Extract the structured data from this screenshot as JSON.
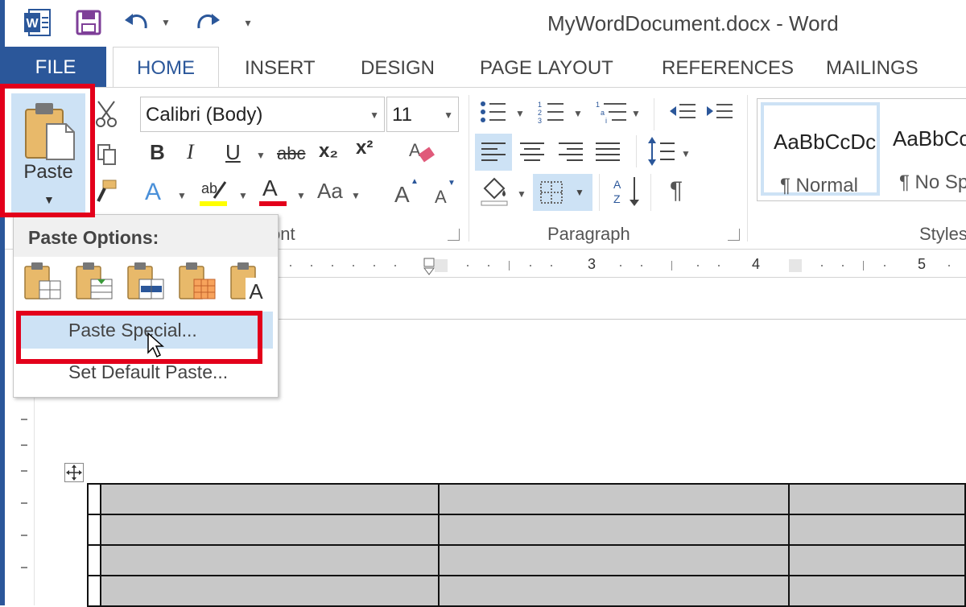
{
  "title_bar": {
    "title": "MyWordDocument.docx - Word",
    "icons": [
      "word-app-icon",
      "save-icon",
      "undo-icon",
      "redo-icon",
      "customize-qat-icon"
    ]
  },
  "tabs": [
    {
      "label": "FILE"
    },
    {
      "label": "HOME"
    },
    {
      "label": "INSERT"
    },
    {
      "label": "DESIGN"
    },
    {
      "label": "PAGE LAYOUT"
    },
    {
      "label": "REFERENCES"
    },
    {
      "label": "MAILINGS"
    }
  ],
  "clipboard": {
    "paste_label": "Paste"
  },
  "font": {
    "name": "Calibri (Body)",
    "size": "11",
    "group_label_partial": "ont",
    "bold": "B",
    "italic": "I",
    "underline": "U",
    "strike": "abc",
    "subscript": "x₂",
    "superscript": "x²",
    "change_case": "Aa",
    "grow": "A",
    "shrink": "A",
    "font_color_glyph": "A",
    "effects_glyph": "A"
  },
  "paragraph": {
    "group_label": "Paragraph",
    "pilcrow": "¶"
  },
  "styles": {
    "group_label_partial": "Styles",
    "items": [
      {
        "sample": "AaBbCcDc",
        "name": "¶ Normal"
      },
      {
        "sample": "AaBbCc",
        "name": "¶ No Spa"
      }
    ]
  },
  "ruler": {
    "numbers": [
      "3",
      "4",
      "5"
    ]
  },
  "paste_menu": {
    "header": "Paste Options:",
    "options": [
      "keep-source-formatting-icon",
      "merge-table-icon",
      "nest-table-icon",
      "overwrite-cells-icon",
      "keep-text-only-icon"
    ],
    "paste_special": "Paste Special...",
    "set_default_paste": "Set Default Paste..."
  },
  "colors": {
    "word_blue": "#2b579a",
    "highlight_blue": "#cde2f5",
    "annotation_red": "#e3001b",
    "table_fill": "#c8c8c8"
  }
}
